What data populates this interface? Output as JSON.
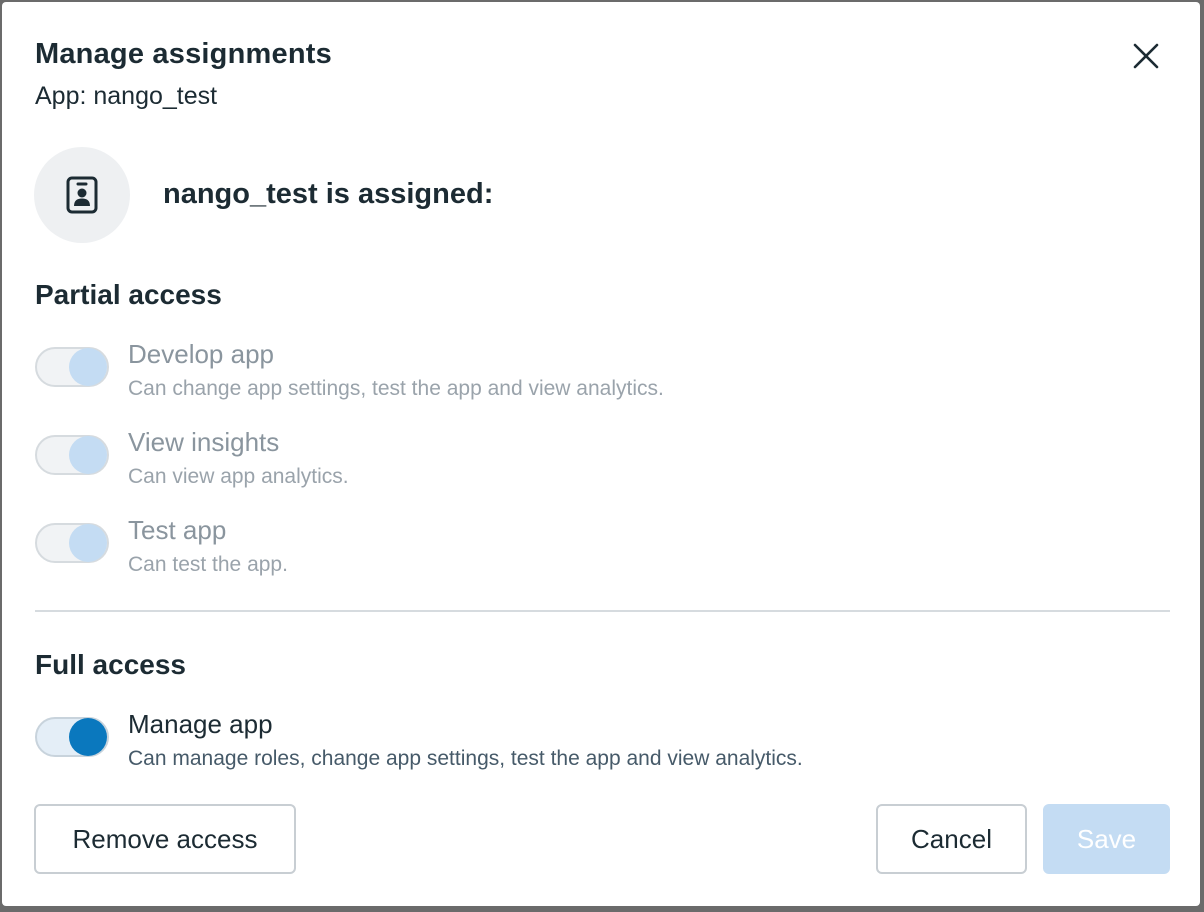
{
  "dialog": {
    "title": "Manage assignments",
    "subtitle": "App: nango_test",
    "close_icon": "close-icon"
  },
  "assignee": {
    "icon": "id-badge-icon",
    "heading": "nango_test is assigned:"
  },
  "partial_access": {
    "heading": "Partial access",
    "items": [
      {
        "label": "Develop app",
        "description": "Can change app settings, test the app and view analytics.",
        "enabled": true,
        "disabled": true
      },
      {
        "label": "View insights",
        "description": "Can view app analytics.",
        "enabled": true,
        "disabled": true
      },
      {
        "label": "Test app",
        "description": "Can test the app.",
        "enabled": true,
        "disabled": true
      }
    ]
  },
  "full_access": {
    "heading": "Full access",
    "items": [
      {
        "label": "Manage app",
        "description": "Can manage roles, change app settings, test the app and view analytics.",
        "enabled": true,
        "disabled": false
      }
    ]
  },
  "footer": {
    "remove_label": "Remove access",
    "cancel_label": "Cancel",
    "save_label": "Save"
  },
  "colors": {
    "accent": "#0a78be",
    "accent_disabled": "#c4dcf3",
    "text_primary": "#1c2b33",
    "text_muted": "#8a959e"
  }
}
